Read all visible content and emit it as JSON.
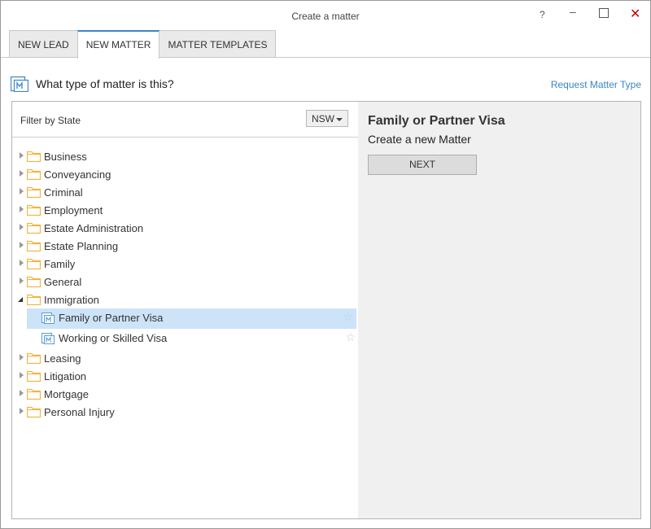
{
  "window": {
    "title": "Create a matter",
    "help_label": "?",
    "close_label": "✕"
  },
  "tabs": [
    {
      "label": "NEW LEAD"
    },
    {
      "label": "NEW MATTER"
    },
    {
      "label": "MATTER TEMPLATES"
    }
  ],
  "active_tab": "NEW MATTER",
  "header": {
    "question": "What type of matter is this?",
    "request_link": "Request Matter Type"
  },
  "filter": {
    "label": "Filter by State",
    "state_value": "NSW"
  },
  "tree": {
    "items": [
      {
        "label": "Business"
      },
      {
        "label": "Conveyancing"
      },
      {
        "label": "Criminal"
      },
      {
        "label": "Employment"
      },
      {
        "label": "Estate Administration"
      },
      {
        "label": "Estate Planning"
      },
      {
        "label": "Family"
      },
      {
        "label": "General"
      },
      {
        "label": "Immigration",
        "expanded": true,
        "children": [
          {
            "label": "Family or Partner Visa",
            "selected": true
          },
          {
            "label": "Working or Skilled Visa"
          }
        ]
      },
      {
        "label": "Leasing"
      },
      {
        "label": "Litigation"
      },
      {
        "label": "Mortgage"
      },
      {
        "label": "Personal Injury"
      }
    ]
  },
  "detail": {
    "title": "Family or Partner Visa",
    "subtitle": "Create a new Matter",
    "next_label": "NEXT"
  },
  "colors": {
    "accent": "#3a86c8",
    "selection": "#cde3f7",
    "folder": "#f2b43c",
    "close": "#cc0000"
  }
}
